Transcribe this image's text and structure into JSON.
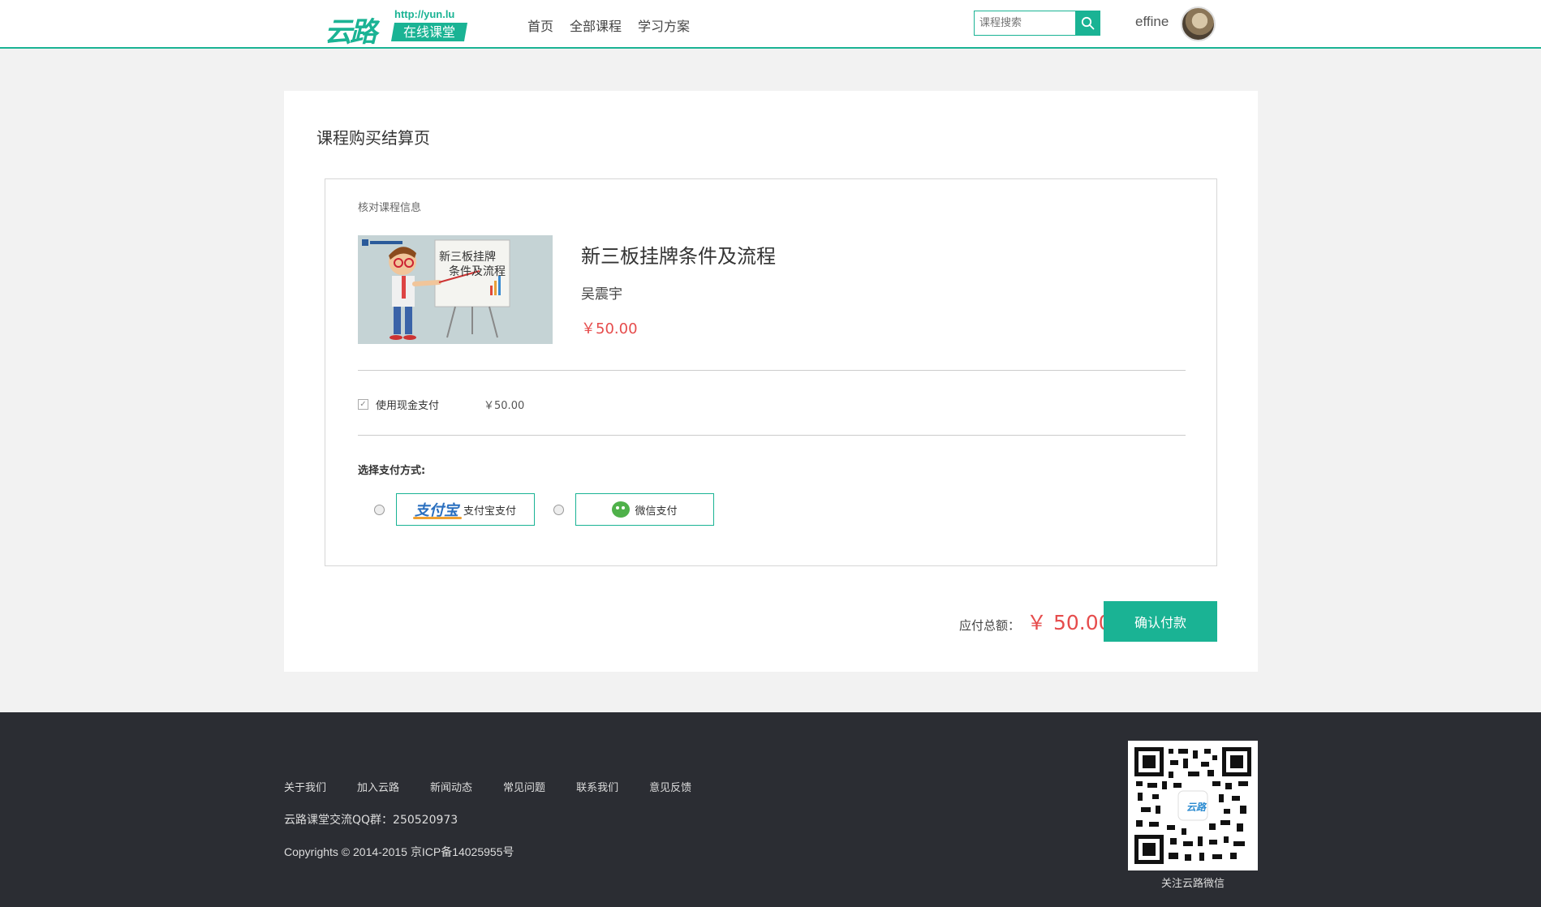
{
  "header": {
    "logo_mark": "云路",
    "logo_url": "http://yun.lu",
    "logo_tag": "在线课堂",
    "nav": [
      {
        "label": "首页"
      },
      {
        "label": "全部课程"
      },
      {
        "label": "学习方案"
      }
    ],
    "search_placeholder": "课程搜索",
    "username": "effine"
  },
  "main": {
    "title": "课程购买结算页",
    "section_label": "核对课程信息",
    "course": {
      "title": "新三板挂牌条件及流程",
      "teacher": "吴震宇",
      "price": "￥50.00",
      "thumb_text_line1": "新三板挂牌",
      "thumb_text_line2": "条件及流程"
    },
    "cash": {
      "label": "使用现金支付",
      "amount": "￥50.00",
      "checked": true
    },
    "pay_label": "选择支付方式:",
    "pay_methods": [
      {
        "logo": "支付宝",
        "label": "支付宝支付"
      },
      {
        "logo": "",
        "label": "微信支付"
      }
    ],
    "total_label": "应付总额：",
    "total_amount": "￥ 50.00",
    "confirm_label": "确认付款"
  },
  "footer": {
    "links": [
      {
        "label": "关于我们"
      },
      {
        "label": "加入云路"
      },
      {
        "label": "新闻动态"
      },
      {
        "label": "常见问题"
      },
      {
        "label": "联系我们"
      },
      {
        "label": "意见反馈"
      }
    ],
    "qq_group": "云路课堂交流QQ群：250520973",
    "copyright": "Copyrights © 2014-2015   京ICP备14025955号",
    "qr_caption": "关注云路微信",
    "qr_center_text": "云路"
  },
  "colors": {
    "accent": "#1ab394",
    "price": "#e64c4c",
    "footer_bg": "#2b2d33"
  }
}
